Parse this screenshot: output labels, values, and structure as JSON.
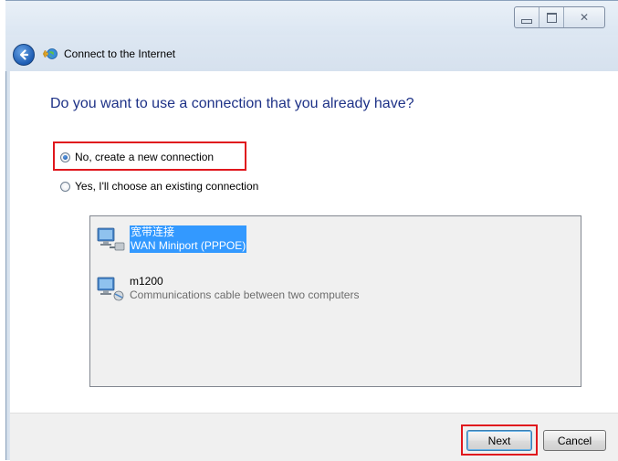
{
  "window": {
    "caption": {
      "minimize_icon": "minimize-icon",
      "maximize_icon": "maximize-icon",
      "close_icon": "close-icon",
      "close_glyph": "✕"
    }
  },
  "navbar": {
    "title": "Connect to the Internet",
    "back_icon": "back-arrow-icon",
    "app_icon": "network-globe-icon"
  },
  "main": {
    "heading": "Do you want to use a connection that you already have?",
    "options": [
      {
        "label": "No, create a new connection",
        "selected": true
      },
      {
        "label": "Yes, I'll choose an existing connection",
        "selected": false
      }
    ],
    "connections": [
      {
        "name": "宽带连接",
        "description": "WAN Miniport (PPPOE)",
        "selected": true,
        "icon": "network-connection-icon"
      },
      {
        "name": "m1200",
        "description": "Communications cable between two computers",
        "selected": false,
        "icon": "cable-connection-icon"
      }
    ]
  },
  "footer": {
    "next_label": "Next",
    "cancel_label": "Cancel"
  },
  "colors": {
    "heading": "#1e3287",
    "selection": "#3399ff",
    "highlight": "#e0171d"
  }
}
